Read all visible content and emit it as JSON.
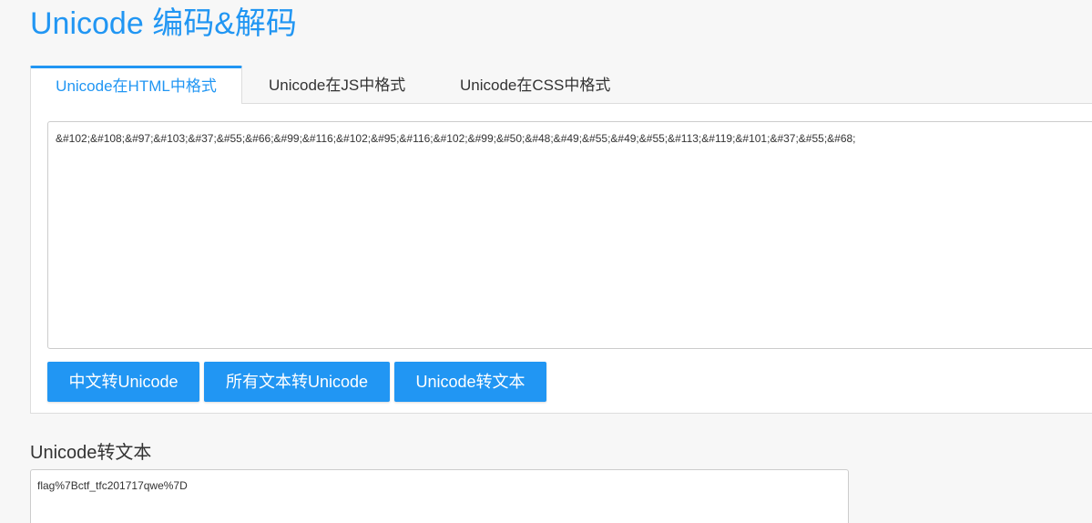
{
  "page": {
    "title": "Unicode 编码&解码"
  },
  "colors": {
    "accent": "#2196f3",
    "title": "#2196f3",
    "background": "#f7f7f7",
    "panel": "#ffffff",
    "border": "#dddddd"
  },
  "tabs": [
    {
      "label": "Unicode在HTML中格式",
      "active": true
    },
    {
      "label": "Unicode在JS中格式",
      "active": false
    },
    {
      "label": "Unicode在CSS中格式",
      "active": false
    }
  ],
  "input": {
    "value": "&#102;&#108;&#97;&#103;&#37;&#55;&#66;&#99;&#116;&#102;&#95;&#116;&#102;&#99;&#50;&#48;&#49;&#55;&#49;&#55;&#113;&#119;&#101;&#37;&#55;&#68;"
  },
  "buttons": {
    "chinese_to_unicode": "中文转Unicode",
    "all_text_to_unicode": "所有文本转Unicode",
    "unicode_to_text": "Unicode转文本"
  },
  "result": {
    "label": "Unicode转文本",
    "value": "flag%7Bctf_tfc201717qwe%7D"
  }
}
